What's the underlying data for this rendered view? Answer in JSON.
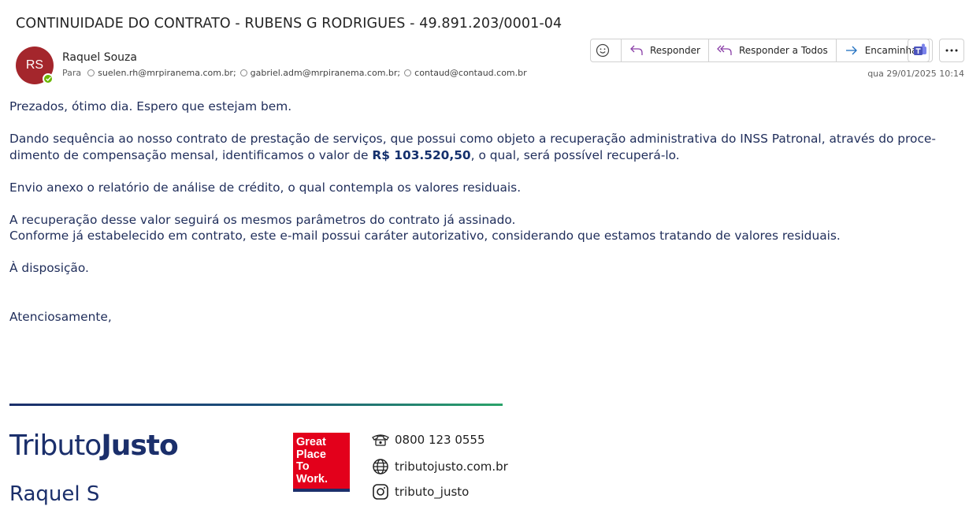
{
  "email": {
    "subject": "CONTINUIDADE DO CONTRATO - RUBENS G RODRIGUES - 49.891.203/0001-04",
    "sender_initials": "RS",
    "sender_name": "Raquel Souza",
    "to_label": "Para",
    "recipients": [
      "suelen.rh@mrpiranema.com.br;",
      "gabriel.adm@mrpiranema.com.br;",
      "contaud@contaud.com.br"
    ],
    "date": "qua 29/01/2025 10:14"
  },
  "toolbar": {
    "reply": "Responder",
    "reply_all": "Responder a Todos",
    "forward": "Encaminhar"
  },
  "body": {
    "greeting": "Prezados, ótimo dia. Espero que estejam bem.",
    "p1_line1": "Dando sequência ao nosso contrato de prestação de serviços, que possui como objeto a recuperação administrativa do INSS Patronal, através do proce-",
    "p1_line2_a": "dimento de compensação mensal, identificamos o valor de ",
    "p1_amount": "R$ 103.520,50",
    "p1_line2_b": ", o qual, será possível recuperá-lo.",
    "p2": "Envio anexo o relatório de análise de crédito, o qual contempla os valores residuais.",
    "p3_line1": "A recuperação desse valor seguirá os mesmos parâmetros do contrato já assinado.",
    "p3_line2": "Conforme já estabelecido em contrato, este e-mail possui caráter autorizativo, considerando que estamos tratando de valores residuais.",
    "p4": "À disposição.",
    "closing": "Atenciosamente,"
  },
  "signature": {
    "logo_part1": "Tributo",
    "logo_part2": "Justo",
    "name_partial": "Raquel S",
    "gptw_text": [
      "Great",
      "Place",
      "To",
      "Work."
    ],
    "phone": "0800 123 0555",
    "website": "tributojusto.com.br",
    "instagram": "tributo_justo",
    "colors": {
      "brand": "#1b2f6b",
      "accent_green": "#2aa36a",
      "gptw_red": "#e3001b"
    }
  }
}
